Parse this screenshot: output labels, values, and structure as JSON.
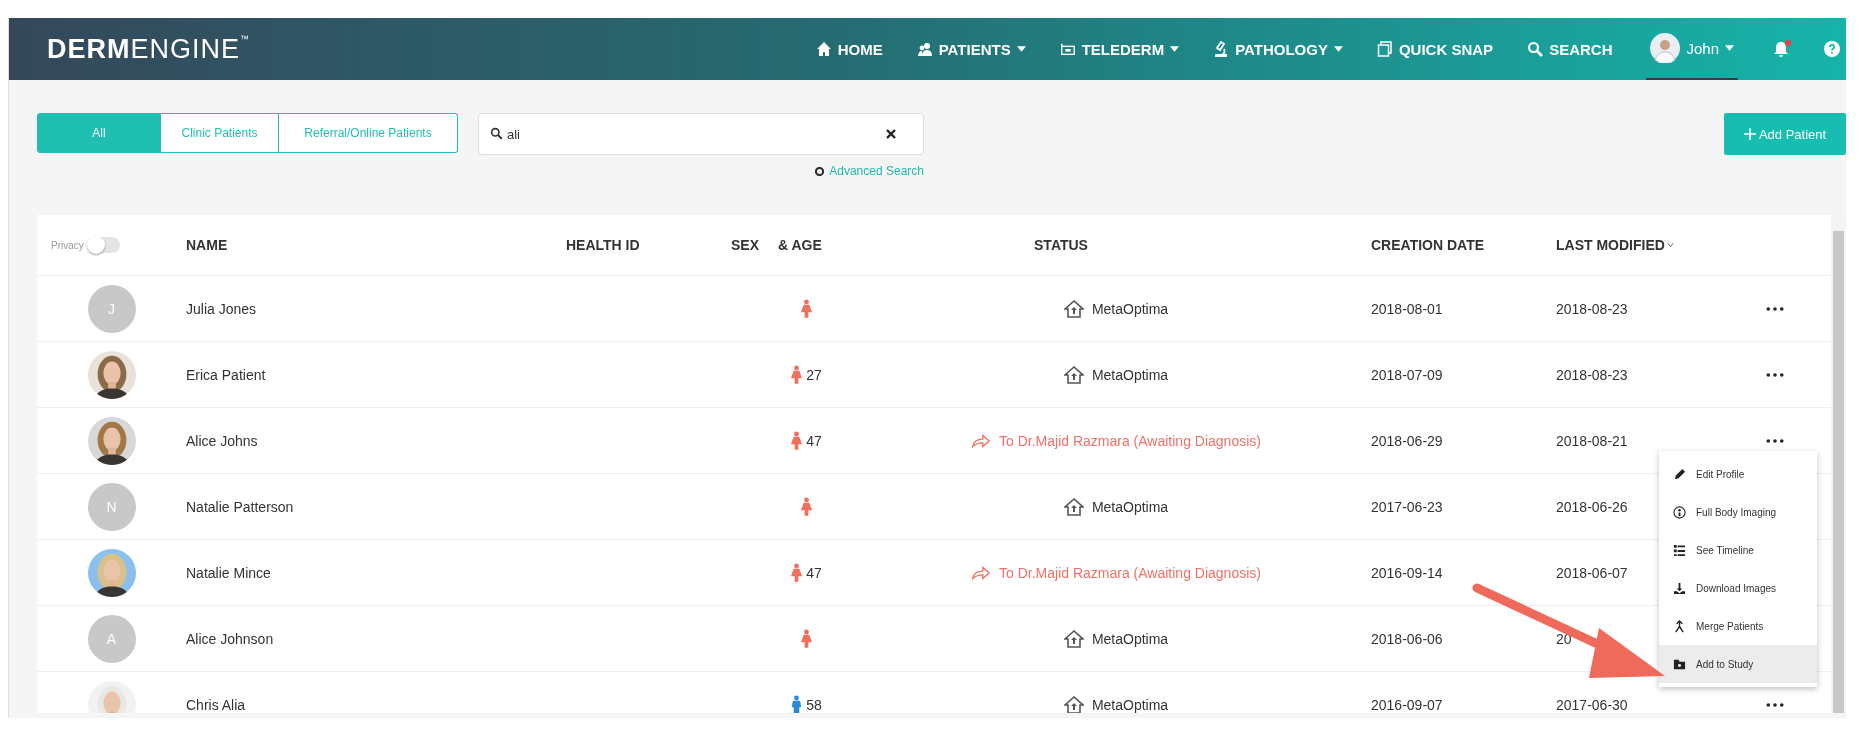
{
  "header": {
    "logo_bold": "DERM",
    "logo_light": "ENGINE",
    "logo_mark": "™",
    "nav": [
      {
        "label": "HOME",
        "kind": "home",
        "dropdown": false
      },
      {
        "label": "PATIENTS",
        "kind": "patients",
        "dropdown": true
      },
      {
        "label": "TELEDERM",
        "kind": "telederm",
        "dropdown": true
      },
      {
        "label": "PATHOLOGY",
        "kind": "pathology",
        "dropdown": true
      },
      {
        "label": "QUICK SNAP",
        "kind": "snap",
        "dropdown": false
      },
      {
        "label": "SEARCH",
        "kind": "search",
        "dropdown": false
      }
    ],
    "user": {
      "name": "John"
    },
    "notification": true
  },
  "filters": [
    {
      "label": "All",
      "selected": true
    },
    {
      "label": "Clinic Patients",
      "selected": false
    },
    {
      "label": "Referral/Online Patients",
      "selected": false
    }
  ],
  "search": {
    "value": "ali"
  },
  "advanced_search": "Advanced Search",
  "add_patient": "Add Patient",
  "privacy": {
    "label": "Privacy",
    "on": false
  },
  "columns": [
    {
      "label": "NAME"
    },
    {
      "label": "HEALTH ID"
    },
    {
      "label": "SEX"
    },
    {
      "label": "& AGE"
    },
    {
      "label": "STATUS"
    },
    {
      "label": "CREATION DATE"
    },
    {
      "label": "LAST MODIFIED",
      "sorted": true
    }
  ],
  "rows": [
    {
      "avatar": {
        "kind": "initial",
        "text": "J"
      },
      "name": "Julia Jones",
      "sex": {
        "kind": "female"
      },
      "status": {
        "kind": "clinic",
        "text": "MetaOptima"
      },
      "created": "2018-08-01",
      "modified": "2018-08-23"
    },
    {
      "name": "Erica Patient",
      "sex": {
        "kind": "female",
        "age": "27"
      },
      "status": {
        "kind": "clinic",
        "text": "MetaOptima"
      },
      "created": "2018-07-09",
      "modified": "2018-08-23"
    },
    {
      "name": "Alice Johns",
      "sex": {
        "kind": "female",
        "age": "47"
      },
      "status": {
        "kind": "referral",
        "text": "To Dr.Majid Razmara (Awaiting Diagnosis)"
      },
      "created": "2018-06-29",
      "modified": "2018-08-21"
    },
    {
      "avatar": {
        "kind": "initial",
        "text": "N"
      },
      "name": "Natalie Patterson",
      "sex": {
        "kind": "female"
      },
      "status": {
        "kind": "clinic",
        "text": "MetaOptima"
      },
      "created": "2017-06-23",
      "modified": "2018-06-26"
    },
    {
      "name": "Natalie Mince",
      "sex": {
        "kind": "female",
        "age": "47"
      },
      "status": {
        "kind": "referral",
        "text": "To Dr.Majid Razmara (Awaiting Diagnosis)"
      },
      "created": "2016-09-14",
      "modified": "2018-06-07"
    },
    {
      "avatar": {
        "kind": "initial",
        "text": "A"
      },
      "name": "Alice Johnson",
      "sex": {
        "kind": "female"
      },
      "status": {
        "kind": "clinic",
        "text": "MetaOptima"
      },
      "created": "2018-06-06",
      "modified": "20"
    },
    {
      "name": "Chris Alia",
      "sex": {
        "kind": "male",
        "age": "58"
      },
      "status": {
        "kind": "clinic",
        "text": "MetaOptima"
      },
      "created": "2016-09-07",
      "modified": "2017-06-30"
    }
  ],
  "row_menu": [
    {
      "label": "Edit Profile",
      "kind": "edit",
      "selected": false
    },
    {
      "label": "Full Body Imaging",
      "kind": "imaging",
      "selected": false
    },
    {
      "label": "See Timeline",
      "kind": "timeline",
      "selected": false
    },
    {
      "label": "Download Images",
      "kind": "download",
      "selected": false
    },
    {
      "label": "Merge Patients",
      "kind": "merge",
      "selected": false
    },
    {
      "label": "Add to Study",
      "kind": "study",
      "selected": true
    }
  ]
}
